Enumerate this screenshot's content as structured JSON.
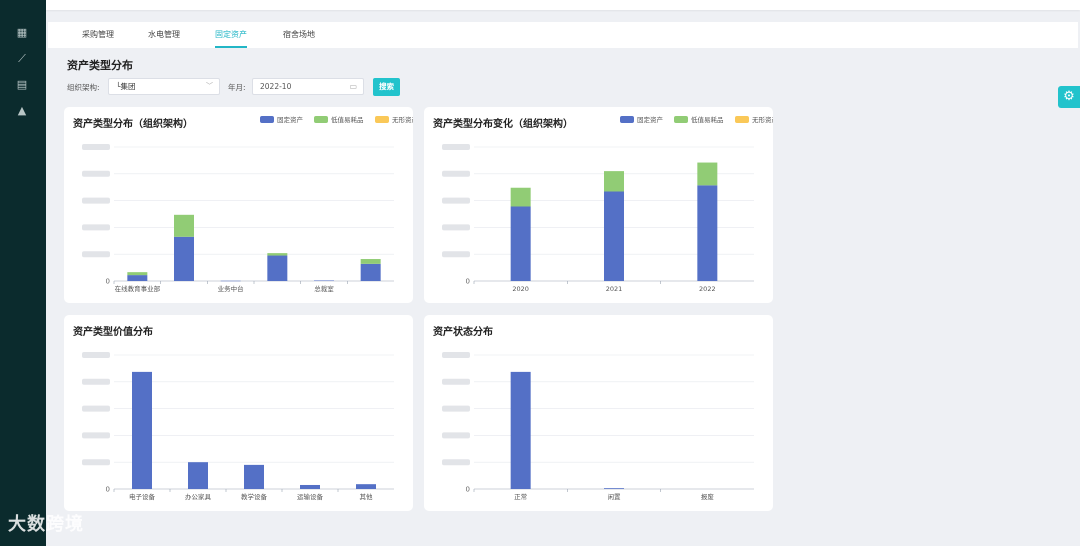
{
  "sidebar": {
    "icons": [
      "dashboard-icon",
      "trend-icon",
      "layout-icon",
      "rocket-icon"
    ]
  },
  "tabs": [
    "采购管理",
    "水电管理",
    "固定资产",
    "宿舍场地"
  ],
  "active_tab": 2,
  "page_title": "资产类型分布",
  "filters": {
    "org_label": "组织架构:",
    "org_value": "└集团",
    "month_label": "年月:",
    "month_value": "2022-10",
    "search_label": "搜索"
  },
  "colors": {
    "blue": "#5470c6",
    "green": "#91cc75",
    "yellow": "#fac858",
    "accent": "#22c3cc"
  },
  "chart_data": [
    {
      "type": "bar",
      "title": "资产类型分布（组织架构）",
      "stacked": true,
      "categories": [
        "在线教育事业部",
        "",
        "业务中台",
        "",
        "总裁室",
        ""
      ],
      "series": [
        {
          "name": "固定资产",
          "color": "#5470c6",
          "values": [
            220,
            1650,
            10,
            950,
            20,
            640
          ]
        },
        {
          "name": "低值易耗品",
          "color": "#91cc75",
          "values": [
            110,
            820,
            0,
            90,
            0,
            180
          ]
        },
        {
          "name": "无形资产",
          "color": "#fac858",
          "values": [
            0,
            0,
            0,
            0,
            0,
            0
          ]
        }
      ],
      "y_ticks": [
        "0",
        "",
        "",
        "",
        "",
        ""
      ],
      "ylim": [
        0,
        5000
      ],
      "legend": "top-right",
      "grid": true
    },
    {
      "type": "bar",
      "title": "资产类型分布变化（组织架构）",
      "stacked": true,
      "categories": [
        "2020",
        "2021",
        "2022"
      ],
      "series": [
        {
          "name": "固定资产",
          "color": "#5470c6",
          "values": [
            2780,
            3340,
            3570
          ]
        },
        {
          "name": "低值易耗品",
          "color": "#91cc75",
          "values": [
            700,
            760,
            850
          ]
        },
        {
          "name": "无形资产",
          "color": "#fac858",
          "values": [
            0,
            0,
            0
          ]
        }
      ],
      "y_ticks": [
        "0",
        "",
        "",
        "",
        "",
        ""
      ],
      "ylim": [
        0,
        5000
      ],
      "legend": "top-right",
      "grid": true
    },
    {
      "type": "bar",
      "title": "资产类型价值分布",
      "stacked": false,
      "categories": [
        "电子设备",
        "办公家具",
        "教学设备",
        "运输设备",
        "其他"
      ],
      "series": [
        {
          "name": "",
          "color": "#5470c6",
          "values": [
            4370,
            1000,
            900,
            150,
            180
          ]
        }
      ],
      "y_ticks": [
        "0",
        "",
        "",
        "",
        "",
        ""
      ],
      "ylim": [
        0,
        5000
      ],
      "grid": true
    },
    {
      "type": "bar",
      "title": "资产状态分布",
      "stacked": false,
      "categories": [
        "正常",
        "闲置",
        "报废"
      ],
      "series": [
        {
          "name": "",
          "color": "#5470c6",
          "values": [
            4370,
            30,
            0
          ]
        }
      ],
      "y_ticks": [
        "0",
        "",
        "",
        "",
        "",
        ""
      ],
      "ylim": [
        0,
        5000
      ],
      "grid": true
    }
  ],
  "watermark": "大数跨境"
}
